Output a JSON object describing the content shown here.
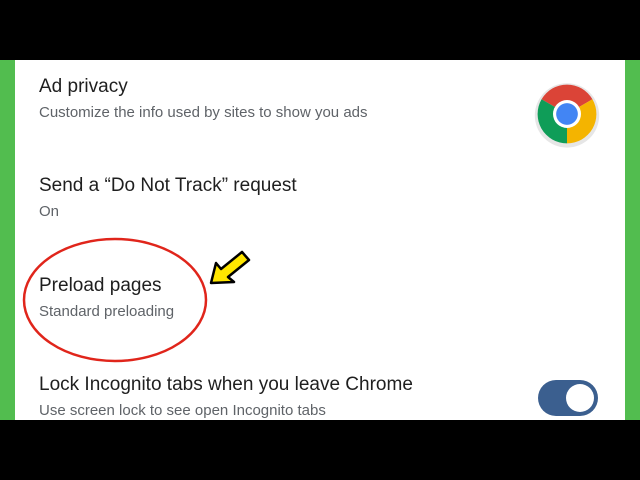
{
  "settings": {
    "ad_privacy": {
      "title": "Ad privacy",
      "subtitle": "Customize the info used by sites to show you ads"
    },
    "do_not_track": {
      "title": "Send a “Do Not Track” request",
      "subtitle": "On"
    },
    "preload_pages": {
      "title": "Preload pages",
      "subtitle": "Standard preloading"
    },
    "lock_incognito": {
      "title": "Lock Incognito tabs when you leave Chrome",
      "subtitle": "Use screen lock to see open Incognito tabs",
      "toggle_on": true
    }
  },
  "icons": {
    "logo": "chrome-logo-icon",
    "pointer": "arrow-pointer-icon"
  },
  "colors": {
    "side_bars": "#52bd4f",
    "highlight": "#e0251b",
    "arrow": "#ffe600",
    "toggle_track": "#3b5f8f"
  }
}
